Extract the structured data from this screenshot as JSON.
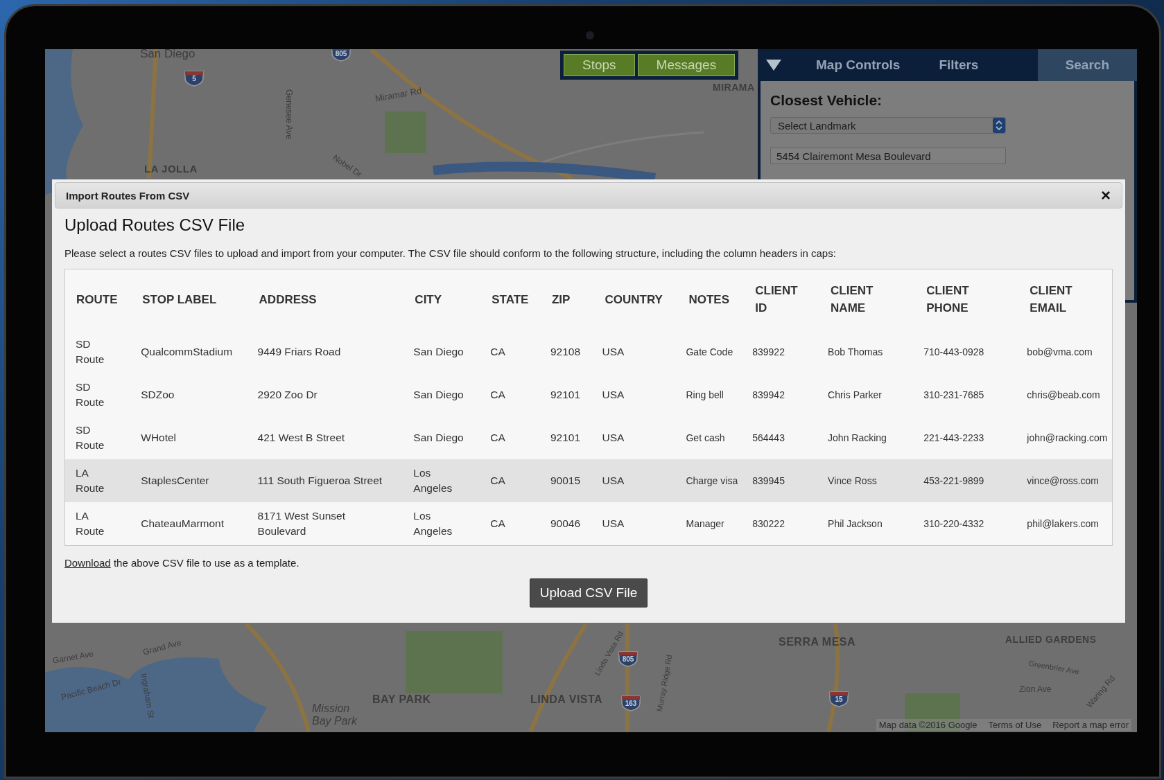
{
  "map": {
    "labels": [
      "San Diego",
      "Miramar Rd",
      "MIRAMA",
      "LA JOLLA",
      "Genesee Ave",
      "Nobel Dr",
      "Garnet Ave",
      "Grand Ave",
      "Pacific Beach Dr",
      "Ingraham St",
      "BAY PARK",
      "Mission Bay Park",
      "LINDA VISTA",
      "Linda Vista Rd",
      "Murray Ridge Rd",
      "SERRA MESA",
      "ALLIED GARDENS",
      "Greenbrier Ave",
      "Zion Ave",
      "Waring Rd"
    ],
    "shields": [
      "805",
      "5",
      "805",
      "163",
      "15"
    ],
    "attribution": [
      "Map data ©2016 Google",
      "Terms of Use",
      "Report a map error"
    ]
  },
  "map_tabs": [
    {
      "label": "Stops"
    },
    {
      "label": "Messages"
    }
  ],
  "side_panel": {
    "tabs": [
      {
        "label": "Map Controls",
        "selected": false
      },
      {
        "label": "Filters",
        "selected": false
      },
      {
        "label": "Search",
        "selected": true
      }
    ],
    "heading": "Closest Vehicle:",
    "landmark_select": {
      "value": "Select Landmark"
    },
    "address_field": {
      "value": "5454 Clairemont Mesa Boulevard"
    }
  },
  "dialog": {
    "title": "Import Routes From CSV",
    "close": "×",
    "heading": "Upload Routes CSV File",
    "intro": "Please select a routes CSV files to upload and import from your computer. The CSV file should conform to the following structure, including the column headers in caps:",
    "table": {
      "columns": [
        "ROUTE",
        "STOP LABEL",
        "ADDRESS",
        "CITY",
        "STATE",
        "ZIP",
        "COUNTRY",
        "NOTES",
        "CLIENT ID",
        "CLIENT NAME",
        "CLIENT PHONE",
        "CLIENT EMAIL"
      ],
      "rows": [
        {
          "highlighted": false,
          "cells": [
            "SD Route",
            "QualcommStadium",
            "9449 Friars Road",
            "San Diego",
            "CA",
            "92108",
            "USA",
            "Gate Code",
            "839922",
            "Bob Thomas",
            "710-443-0928",
            "bob@vma.com"
          ]
        },
        {
          "highlighted": false,
          "cells": [
            "SD Route",
            "SDZoo",
            "2920 Zoo Dr",
            "San Diego",
            "CA",
            "92101",
            "USA",
            "Ring bell",
            "839942",
            "Chris Parker",
            "310-231-7685",
            "chris@beab.com"
          ]
        },
        {
          "highlighted": false,
          "cells": [
            "SD Route",
            "WHotel",
            "421 West B Street",
            "San Diego",
            "CA",
            "92101",
            "USA",
            "Get cash",
            "564443",
            "John Racking",
            "221-443-2233",
            "john@racking.com"
          ]
        },
        {
          "highlighted": true,
          "cells": [
            "LA Route",
            "StaplesCenter",
            "111 South Figueroa Street",
            "Los Angeles",
            "CA",
            "90015",
            "USA",
            "Charge visa",
            "839945",
            "Vince Ross",
            "453-221-9899",
            "vince@ross.com"
          ]
        },
        {
          "highlighted": false,
          "cells": [
            "LA Route",
            "ChateauMarmont",
            "8171 West Sunset Boulevard",
            "Los Angeles",
            "CA",
            "90046",
            "USA",
            "Manager",
            "830222",
            "Phil Jackson",
            "310-220-4332",
            "phil@lakers.com"
          ]
        }
      ]
    },
    "template_link": "Download",
    "template_text": " the above CSV file to use as a template.",
    "upload_button": "Upload CSV File"
  }
}
